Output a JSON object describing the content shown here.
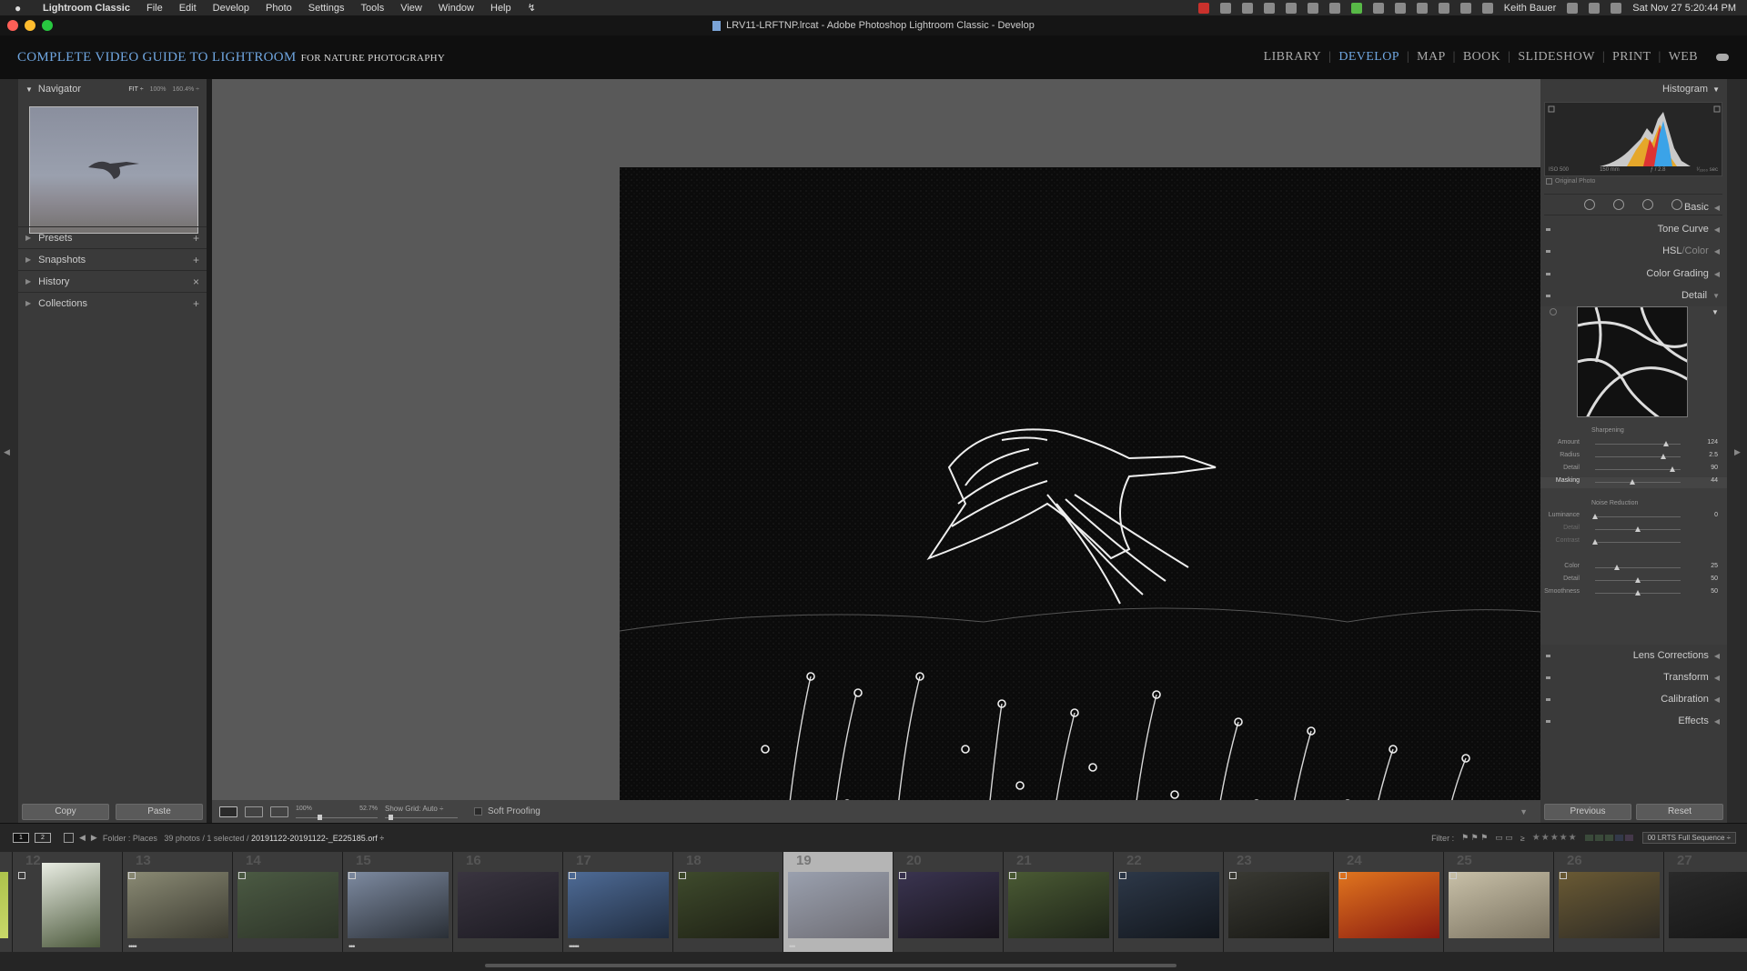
{
  "menubar": {
    "app_name": "Lightroom Classic",
    "menus": [
      "File",
      "Edit",
      "Develop",
      "Photo",
      "Settings",
      "Tools",
      "View",
      "Window",
      "Help"
    ],
    "user": "Keith Bauer",
    "clock": "Sat Nov 27  5:20:44 PM"
  },
  "window": {
    "title": "LRV11-LRFTNP.lrcat - Adobe Photoshop Lightroom Classic - Develop"
  },
  "identity": {
    "main": "Complete Video Guide to Lightroom",
    "sub": "for Nature Photography"
  },
  "modules": {
    "items": [
      "LIBRARY",
      "DEVELOP",
      "MAP",
      "BOOK",
      "SLIDESHOW",
      "PRINT",
      "WEB"
    ],
    "active": "DEVELOP"
  },
  "left_panel": {
    "navigator_title": "Navigator",
    "zoom_options": [
      "FIT ÷",
      "100%",
      "160.4% ÷"
    ],
    "sections": [
      {
        "label": "Presets",
        "action": "+"
      },
      {
        "label": "Snapshots",
        "action": "+"
      },
      {
        "label": "History",
        "action": "×"
      },
      {
        "label": "Collections",
        "action": "+"
      }
    ],
    "copy_label": "Copy",
    "paste_label": "Paste"
  },
  "toolbar": {
    "zoom_left": "100%",
    "zoom_right": "52.7%",
    "show_grid_label": "Show Grid:",
    "show_grid_value": "Auto ÷",
    "soft_proofing": "Soft Proofing"
  },
  "right_panel": {
    "histogram_title": "Histogram",
    "histo_meta": [
      "ISO 500",
      "150 mm",
      "ƒ / 2.8",
      "¹⁄₁₆₀₀ sec"
    ],
    "original_photo": "Original Photo",
    "sections_top": [
      "Basic",
      "Tone Curve"
    ],
    "hsl": {
      "a": "HSL",
      "sep": " / ",
      "b": "Color"
    },
    "color_grading": "Color Grading",
    "detail": "Detail",
    "sharpening_title": "Sharpening",
    "sharpening": [
      {
        "label": "Amount",
        "value": "124",
        "pos": 0.83
      },
      {
        "label": "Radius",
        "value": "2.5",
        "pos": 0.8
      },
      {
        "label": "Detail",
        "value": "90",
        "pos": 0.9
      },
      {
        "label": "Masking",
        "value": "44",
        "pos": 0.44
      }
    ],
    "noise_title": "Noise Reduction",
    "noise": [
      {
        "label": "Luminance",
        "value": "0",
        "pos": 0.0,
        "dim": false
      },
      {
        "label": "Detail",
        "value": "",
        "pos": 0.5,
        "dim": true
      },
      {
        "label": "Contrast",
        "value": "",
        "pos": 0.0,
        "dim": true
      },
      {
        "label": "Color",
        "value": "25",
        "pos": 0.25,
        "dim": false
      },
      {
        "label": "Detail",
        "value": "50",
        "pos": 0.5,
        "dim": false
      },
      {
        "label": "Smoothness",
        "value": "50",
        "pos": 0.5,
        "dim": false
      }
    ],
    "sections_bottom": [
      "Lens Corrections",
      "Transform",
      "Calibration",
      "Effects"
    ],
    "previous_label": "Previous",
    "reset_label": "Reset"
  },
  "filmbar": {
    "mon1": "1",
    "mon2": "2",
    "folder": "Folder : Places",
    "count": "39 photos / 1 selected /",
    "filename": "20191122-20191122-_E225185.orf ÷",
    "filter_label": "Filter :",
    "stars": "★★★★★",
    "preset": "00 LRTS Full Sequence ÷"
  },
  "filmstrip": {
    "cells": [
      {
        "num": "",
        "colors": [
          "#9fb83c",
          "#c9d86a"
        ],
        "dots": "",
        "badge": false
      },
      {
        "num": "12",
        "colors": [
          "#e8ece2",
          "#4d5a3d"
        ],
        "dots": "",
        "badge": true,
        "portrait": true
      },
      {
        "num": "13",
        "colors": [
          "#8a8a74",
          "#3b3a30"
        ],
        "dots": "••••",
        "badge": true
      },
      {
        "num": "14",
        "colors": [
          "#4b5a43",
          "#2d3428"
        ],
        "dots": "",
        "badge": true
      },
      {
        "num": "15",
        "colors": [
          "#7d8aa0",
          "#2a2f36"
        ],
        "dots": "•••",
        "badge": true
      },
      {
        "num": "16",
        "colors": [
          "#3a3540",
          "#1c1a22"
        ],
        "dots": "",
        "badge": false
      },
      {
        "num": "17",
        "colors": [
          "#4e6b96",
          "#202c3f"
        ],
        "dots": "•••••",
        "badge": true
      },
      {
        "num": "18",
        "colors": [
          "#3e4a2c",
          "#1e2014"
        ],
        "dots": "",
        "badge": true
      },
      {
        "num": "19",
        "colors": [
          "#9aa0ae",
          "#6e6d74"
        ],
        "dots": "•••",
        "badge": false,
        "selected": true
      },
      {
        "num": "20",
        "colors": [
          "#3a3450",
          "#18141c"
        ],
        "dots": "",
        "badge": true
      },
      {
        "num": "21",
        "colors": [
          "#4a5a34",
          "#1e2418"
        ],
        "dots": "",
        "badge": true
      },
      {
        "num": "22",
        "colors": [
          "#2d3848",
          "#12161c"
        ],
        "dots": "",
        "badge": true
      },
      {
        "num": "23",
        "colors": [
          "#3a3a34",
          "#161612"
        ],
        "dots": "",
        "badge": true
      },
      {
        "num": "24",
        "colors": [
          "#e0751e",
          "#8a1a10"
        ],
        "dots": "",
        "badge": true
      },
      {
        "num": "25",
        "colors": [
          "#c8c0a8",
          "#7a7260"
        ],
        "dots": "",
        "badge": true
      },
      {
        "num": "26",
        "colors": [
          "#6a5a34",
          "#2d2a24"
        ],
        "dots": "",
        "badge": true
      },
      {
        "num": "27",
        "colors": [
          "#2a2a2a",
          "#151515"
        ],
        "dots": "",
        "badge": false
      }
    ]
  }
}
